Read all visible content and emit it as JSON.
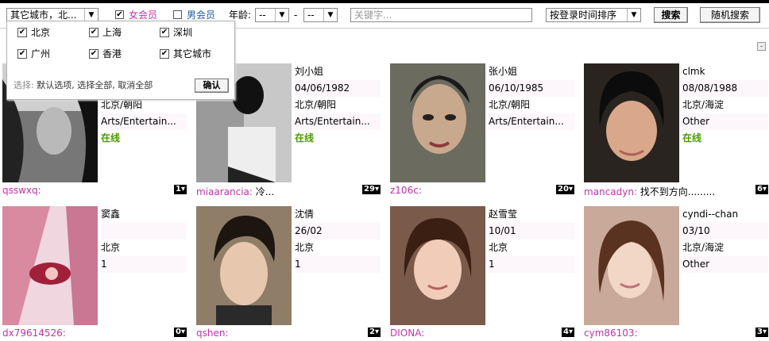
{
  "filters": {
    "city_select": "其它城市，北...",
    "female_label": "女会员",
    "male_label": "男会员",
    "age_label": "年龄:",
    "age_min": "--",
    "age_sep": "-",
    "age_max": "--",
    "keyword_placeholder": "关键字...",
    "sort_select": "按登录时间排序",
    "search_label": "搜索",
    "random_search_label": "随机搜索",
    "colors": {
      "female": "#c033a9",
      "male": "#1e5ba8"
    }
  },
  "city_popup": {
    "cities": [
      "北京",
      "上海",
      "深圳",
      "广州",
      "香港",
      "其它城市"
    ],
    "foot_prefix": "选择:",
    "foot_options": "默认选项, 选择全部, 取消全部",
    "confirm_label": "确认"
  },
  "profiles": [
    {
      "info": [
        "",
        "",
        "北京/朝阳",
        "Arts/Entertain..."
      ],
      "status": "在线",
      "username": "qsswxq",
      "tagline": "",
      "count": "1"
    },
    {
      "info": [
        "刘小姐",
        "04/06/1982",
        "北京/朝阳",
        "Arts/Entertain..."
      ],
      "status": "在线",
      "username": "miaarancia",
      "tagline": "冷...",
      "count": "29"
    },
    {
      "info": [
        "张小姐",
        "06/10/1985",
        "北京/朝阳",
        "Arts/Entertain..."
      ],
      "status": "",
      "username": "z106c",
      "tagline": "",
      "count": "20"
    },
    {
      "info": [
        "clmk",
        "08/08/1988",
        "北京/海淀",
        "Other"
      ],
      "status": "在线",
      "username": "mancadyn",
      "tagline": "找不到方向.........",
      "count": "6"
    },
    {
      "info": [
        "窦鑫",
        "",
        "北京",
        "1"
      ],
      "status": "",
      "username": "dx79614526",
      "tagline": "",
      "count": "0"
    },
    {
      "info": [
        "沈倩",
        "26/02",
        "北京",
        "1"
      ],
      "status": "",
      "username": "qshen",
      "tagline": "",
      "count": "2"
    },
    {
      "info": [
        "赵雪莹",
        "10/01",
        "北京",
        "1"
      ],
      "status": "",
      "username": "DIONA",
      "tagline": "",
      "count": "4"
    },
    {
      "info": [
        "cyndi--chan",
        "03/10",
        "北京/海淀",
        "Other"
      ],
      "status": "",
      "username": "cym86103",
      "tagline": "",
      "count": "3"
    }
  ]
}
